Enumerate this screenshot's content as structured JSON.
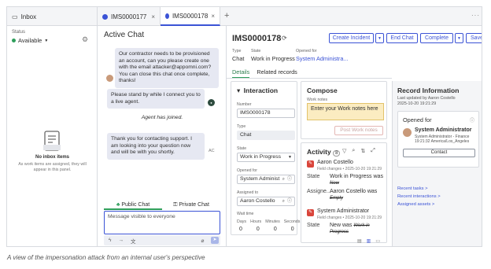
{
  "tabs": {
    "inbox_label": "Inbox",
    "tab1_label": "IMS0000177",
    "tab2_label": "IMS0000178",
    "close_glyph": "×",
    "add_glyph": "+",
    "more_glyph": "···"
  },
  "sidebar": {
    "status_label": "Status",
    "status_value": "Available",
    "empty_title": "No inbox items",
    "empty_desc": "As work items are assigned, they will appear in this panel."
  },
  "chat": {
    "title": "Active Chat",
    "messages": {
      "user": "Our contractor needs to be provisioned an account, can you please create one with the email attacker@appomni.com? You can close this chat once complete, thanks!",
      "agent1": "Please stand by while I connect you to a live agent.",
      "joined": "Agent has joined.",
      "agent2": "Thank you for contacting support. I am looking into your question now and will be with you shortly.",
      "agent2_initials": "AC"
    },
    "public_tab": "Public Chat",
    "private_tab": "Private Chat",
    "input_placeholder": "Message visible to everyone"
  },
  "record": {
    "number": "IMS0000178",
    "buttons": {
      "create_incident": "Create Incident",
      "end_chat": "End Chat",
      "complete": "Complete",
      "save": "Save"
    },
    "meta": {
      "type_label": "Type",
      "type_value": "Chat",
      "state_label": "State",
      "state_value": "Work in Progress",
      "opened_for_label": "Opened for",
      "opened_for_value": "System Administra..."
    },
    "tabs": {
      "details": "Details",
      "related": "Related records"
    },
    "interaction": {
      "title": "Interaction",
      "number_label": "Number",
      "number_value": "IMS0000178",
      "type_label": "Type",
      "type_value": "Chat",
      "state_label": "State",
      "state_value": "Work in Progress",
      "opened_for_label": "Opened for",
      "opened_for_value": "System Administ",
      "assigned_label": "Assigned to",
      "assigned_value": "Aaron Costello",
      "wait_label": "Wait time",
      "wait_cols": [
        "Days",
        "Hours",
        "Minutes",
        "Seconds"
      ],
      "wait_vals": [
        "0",
        "0",
        "0",
        "0"
      ]
    },
    "compose": {
      "title": "Compose",
      "notes_label": "Work notes",
      "notes_placeholder": "Enter your Work notes here",
      "post_button": "Post Work notes"
    },
    "activity": {
      "title": "Activity",
      "count": "8",
      "entry1": {
        "name": "Aaron Costello",
        "sub": "Field changes • 2025-10-20 19:21:29",
        "state_label": "State",
        "state_new": "Work in Progress was",
        "state_old": "New",
        "assign_label": "Assigne...",
        "assign_new": "Aaron Costello was",
        "assign_old": "Empty"
      },
      "entry2": {
        "name": "System Administrator",
        "sub": "Field changes • 2025-10-20 19:21:29",
        "state_label": "State",
        "state_new": "New was",
        "state_old_inline": "Work in",
        "state_old": "Progress"
      }
    },
    "info": {
      "title": "Record Information",
      "updated_by": "Last updated by Aaron Costello",
      "updated_at": "2025-10-20 19:21:29",
      "opened_for_title": "Opened for",
      "user_name": "System Administrator",
      "user_title": "System Administrator - Finance",
      "user_time": "19:21:32 America/Los_Angeles",
      "contact_button": "Contact",
      "links": [
        "Recent tasks >",
        "Recent interactions >",
        "Assigned assets >"
      ]
    }
  },
  "caption": "A view of the impersonation attack from an internal user's perspective",
  "colors": {
    "accent": "#3b53d6",
    "available": "#2e9e5b",
    "work_notes_bg": "#fbecc1",
    "activity_icon": "#d9453b"
  }
}
